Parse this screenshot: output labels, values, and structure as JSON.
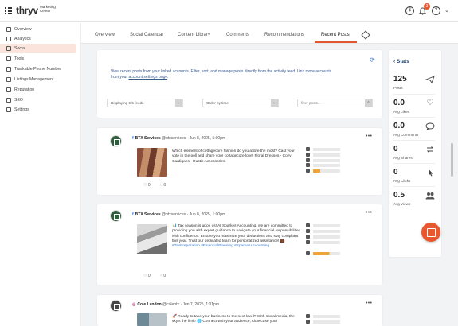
{
  "header": {
    "logo": "thryv",
    "logo_sub_1": "Marketing",
    "logo_sub_2": "Center",
    "notification_count": "3"
  },
  "sidebar": {
    "items": [
      {
        "label": "Overview",
        "icon": "grid-icon"
      },
      {
        "label": "Analytics",
        "icon": "chart-icon"
      },
      {
        "label": "Social",
        "icon": "social-icon",
        "active": true
      },
      {
        "label": "Tools",
        "icon": "tools-icon"
      },
      {
        "label": "Trackable Phone Number",
        "icon": "phone-icon"
      },
      {
        "label": "Listings Management",
        "icon": "listing-icon"
      },
      {
        "label": "Reputation",
        "icon": "reputation-icon"
      },
      {
        "label": "SEO",
        "icon": "seo-icon"
      },
      {
        "label": "Settings",
        "icon": "settings-icon"
      }
    ]
  },
  "tabs": [
    {
      "label": "Overview"
    },
    {
      "label": "Social Calendar"
    },
    {
      "label": "Content Library"
    },
    {
      "label": "Comments"
    },
    {
      "label": "Recommendations"
    },
    {
      "label": "Recent Posts",
      "active": true
    }
  ],
  "intro": {
    "line1": "View recent posts from your linked accounts. Filter, sort, and manage posts directly from the activity feed. Link more accounts",
    "line2_prefix": "from your ",
    "line2_link": "account settings page",
    "line2_suffix": "."
  },
  "filters": {
    "feeds": "Displaying 6/6 feeds",
    "order": "Order by time",
    "search_placeholder": "filter posts..."
  },
  "posts": [
    {
      "network": "f",
      "name": "BTX Services",
      "handle": "@btxservices",
      "date": "· Jun 8, 2025, 5:00pm",
      "text": "Which element of cottagecore fashion do you adore the most? Cast your vote in the poll and share your cottagecore love! Floral Dresses - Cozy Cardigans - Rustic Accessories.",
      "likes": "0",
      "comments": "0"
    },
    {
      "network": "f",
      "name": "BTX Services",
      "handle": "@btxservices",
      "date": "· Jun 8, 2025, 1:00pm",
      "text": "📊 Tax season is upon us! At Sparkes Accounting, we are committed to providing you with expert guidance to navigate your financial responsibilities with confidence. Ensure you maximize your deductions and stay compliant this year. Trust our dedicated team for personalized assistance! 💼",
      "tags": "#TaxPreparation #FinancialPlanning #SparkesAccounting",
      "likes": "0",
      "comments": "0"
    },
    {
      "network": "ig",
      "name": "Cole Landon",
      "handle": "@colebtx",
      "date": "· Jun 7, 2025, 1:01pm",
      "text": "🚀 Ready to take your business to the next level? With social media, the sky's the limit! 🌐 Connect with your audience, showcase your"
    }
  ],
  "stats": {
    "title": "Stats",
    "items": [
      {
        "value": "125",
        "label": "Posts",
        "icon": "send-icon"
      },
      {
        "value": "0.0",
        "label": "Avg Likes",
        "icon": "heart-icon"
      },
      {
        "value": "0.0",
        "label": "Avg Comments",
        "icon": "comment-icon"
      },
      {
        "value": "0",
        "label": "Avg Shares",
        "icon": "share-icon"
      },
      {
        "value": "0",
        "label": "Avg Clicks",
        "icon": "cursor-icon"
      },
      {
        "value": "0.5",
        "label": "Avg Views",
        "icon": "users-icon"
      }
    ]
  },
  "colors": {
    "accent": "#e4572e",
    "link": "#3a7bd5",
    "stats_title": "#2b4a77"
  }
}
